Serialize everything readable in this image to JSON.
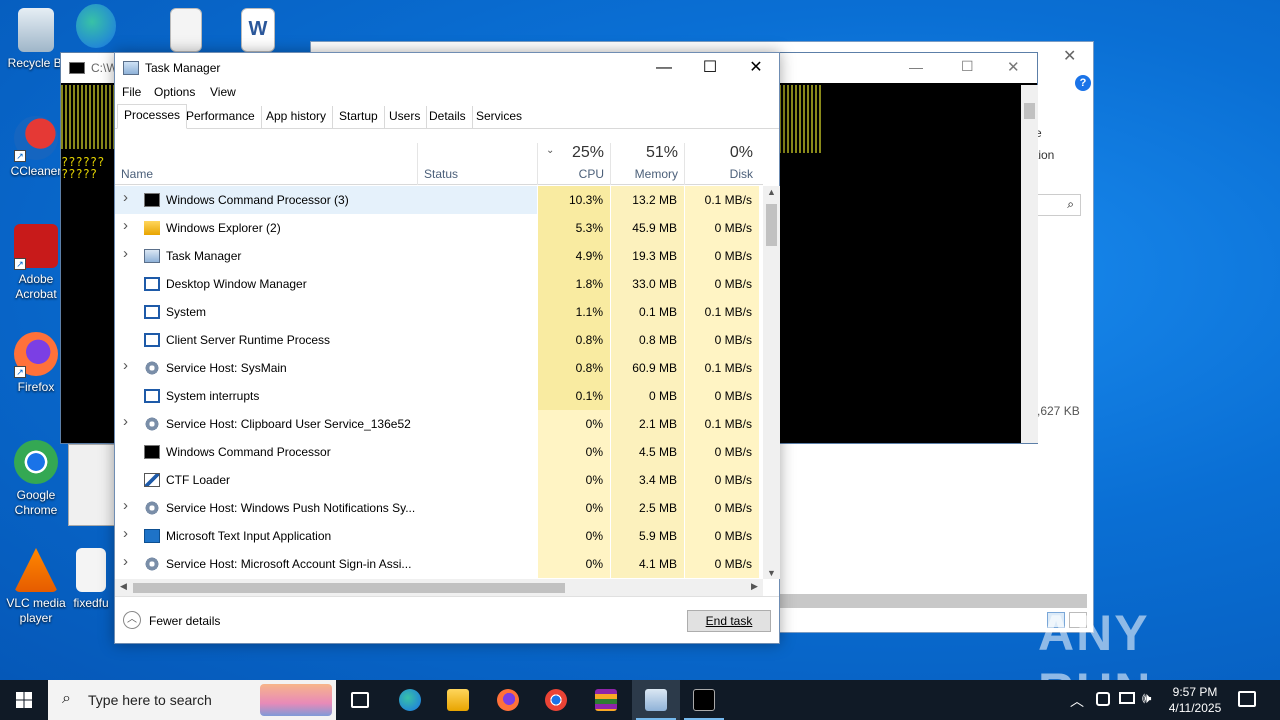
{
  "desktop": {
    "icons": [
      {
        "label": "Recycle Bi",
        "icon": "recycle-bin-icon"
      },
      {
        "label": "CCleaner",
        "icon": "ccleaner-icon"
      },
      {
        "label": "Adobe Acrobat",
        "icon": "acrobat-icon"
      },
      {
        "label": "Firefox",
        "icon": "firefox-icon"
      },
      {
        "label": "Google Chrome",
        "icon": "chrome-icon"
      },
      {
        "label": "VLC media player",
        "icon": "vlc-icon"
      },
      {
        "label": "fixedfu",
        "icon": "image-file-icon"
      }
    ]
  },
  "background_windows": {
    "console_title": "C:\\W",
    "console_text_1": "??????",
    "console_text_2": "?????",
    "explorer_side_1": "e",
    "explorer_side_2": "tion",
    "explorer_size": ",627 KB"
  },
  "task_manager": {
    "title": "Task Manager",
    "menu": [
      "File",
      "Options",
      "View"
    ],
    "tabs": [
      "Processes",
      "Performance",
      "App history",
      "Startup",
      "Users",
      "Details",
      "Services"
    ],
    "active_tab": "Processes",
    "columns": {
      "name": "Name",
      "status": "Status",
      "cpu_pct": "25%",
      "cpu": "CPU",
      "memory_pct": "51%",
      "memory": "Memory",
      "disk_pct": "0%",
      "disk": "Disk"
    },
    "processes": [
      {
        "name": "Windows Command Processor (3)",
        "expandable": true,
        "icon": "cmd-icon",
        "cpu": "10.3%",
        "memory": "13.2 MB",
        "disk": "0.1 MB/s",
        "selected": true
      },
      {
        "name": "Windows Explorer (2)",
        "expandable": true,
        "icon": "explorer-icon",
        "cpu": "5.3%",
        "memory": "45.9 MB",
        "disk": "0 MB/s"
      },
      {
        "name": "Task Manager",
        "expandable": true,
        "icon": "task-manager-icon",
        "cpu": "4.9%",
        "memory": "19.3 MB",
        "disk": "0 MB/s"
      },
      {
        "name": "Desktop Window Manager",
        "expandable": false,
        "icon": "window-icon",
        "cpu": "1.8%",
        "memory": "33.0 MB",
        "disk": "0 MB/s"
      },
      {
        "name": "System",
        "expandable": false,
        "icon": "window-icon",
        "cpu": "1.1%",
        "memory": "0.1 MB",
        "disk": "0.1 MB/s"
      },
      {
        "name": "Client Server Runtime Process",
        "expandable": false,
        "icon": "window-icon",
        "cpu": "0.8%",
        "memory": "0.8 MB",
        "disk": "0 MB/s"
      },
      {
        "name": "Service Host: SysMain",
        "expandable": true,
        "icon": "gear-icon",
        "cpu": "0.8%",
        "memory": "60.9 MB",
        "disk": "0.1 MB/s"
      },
      {
        "name": "System interrupts",
        "expandable": false,
        "icon": "window-icon",
        "cpu": "0.1%",
        "memory": "0 MB",
        "disk": "0 MB/s"
      },
      {
        "name": "Service Host: Clipboard User Service_136e52",
        "expandable": true,
        "icon": "gear-icon",
        "cpu": "0%",
        "memory": "2.1 MB",
        "disk": "0.1 MB/s"
      },
      {
        "name": "Windows Command Processor",
        "expandable": false,
        "icon": "cmd-icon",
        "cpu": "0%",
        "memory": "4.5 MB",
        "disk": "0 MB/s"
      },
      {
        "name": "CTF Loader",
        "expandable": false,
        "icon": "pen-icon",
        "cpu": "0%",
        "memory": "3.4 MB",
        "disk": "0 MB/s"
      },
      {
        "name": "Service Host: Windows Push Notifications Sy...",
        "expandable": true,
        "icon": "gear-icon",
        "cpu": "0%",
        "memory": "2.5 MB",
        "disk": "0 MB/s"
      },
      {
        "name": "Microsoft Text Input Application",
        "expandable": true,
        "icon": "keyboard-icon",
        "cpu": "0%",
        "memory": "5.9 MB",
        "disk": "0 MB/s"
      },
      {
        "name": "Service Host: Microsoft Account Sign-in Assi...",
        "expandable": true,
        "icon": "gear-icon",
        "cpu": "0%",
        "memory": "4.1 MB",
        "disk": "0 MB/s"
      }
    ],
    "fewer_details": "Fewer details",
    "end_task": "End task"
  },
  "taskbar": {
    "search_placeholder": "Type here to search",
    "time": "9:57 PM",
    "date": "4/11/2025"
  },
  "watermark": "ANY RUN",
  "colors": {
    "cpu_heat_high": "#f9eba1",
    "cpu_heat_mid": "#fcf1bd",
    "cpu_heat_low": "#fff4c4",
    "selection": "#e5f1fb",
    "taskbar": "#101a26"
  }
}
